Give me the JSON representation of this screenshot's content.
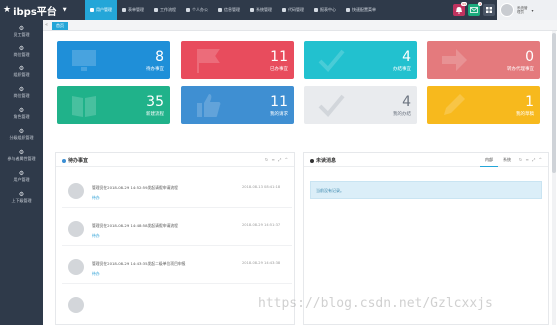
{
  "app": {
    "brand": "ibps平台"
  },
  "topnav": [
    {
      "label": "用户管理",
      "icon": "user-icon",
      "active": true
    },
    {
      "label": "表单管理",
      "icon": "form-icon",
      "active": false
    },
    {
      "label": "工作流程",
      "icon": "flow-icon",
      "active": false
    },
    {
      "label": "个人办公",
      "icon": "office-icon",
      "active": false
    },
    {
      "label": "信息管理",
      "icon": "info-icon",
      "active": false
    },
    {
      "label": "系统管理",
      "icon": "system-icon",
      "active": false
    },
    {
      "label": "代码管理",
      "icon": "code-icon",
      "active": false
    },
    {
      "label": "报表中心",
      "icon": "report-icon",
      "active": false
    },
    {
      "label": "快速配置菜单",
      "icon": "menu-config-icon",
      "active": false
    }
  ],
  "header_badges": [
    {
      "icon": "bell-icon",
      "count": "99",
      "color": "#c0335f"
    },
    {
      "icon": "mail-icon",
      "count": "4",
      "color": "#1bab7d"
    }
  ],
  "user": {
    "line1": "系统管",
    "line2": "理员"
  },
  "sidebar": {
    "items": [
      {
        "label": "员工管理"
      },
      {
        "label": "岗位管理"
      },
      {
        "label": "组织管理"
      },
      {
        "label": "岗位管理"
      },
      {
        "label": "角色管理"
      },
      {
        "label": "分级组织管理"
      },
      {
        "label": "参与者属性管理"
      },
      {
        "label": "用户管理"
      },
      {
        "label": "上下级管理"
      }
    ]
  },
  "tabs": [
    {
      "label": "首页"
    }
  ],
  "cards": [
    {
      "value": "8",
      "label": "待办事宜",
      "color": "#1f8fd8",
      "style": "color"
    },
    {
      "value": "11",
      "label": "已办事宜",
      "color": "#e84c5d",
      "style": "color"
    },
    {
      "value": "4",
      "label": "办结事宜",
      "color": "#22c1cf",
      "style": "color"
    },
    {
      "value": "0",
      "label": "转办代理事宜",
      "color": "#e47a7d",
      "style": "color"
    },
    {
      "value": "35",
      "label": "新建流程",
      "color": "#20b28a",
      "style": "color"
    },
    {
      "value": "11",
      "label": "我的请求",
      "color": "#3f8fd2",
      "style": "color"
    },
    {
      "value": "4",
      "label": "我的办结",
      "color": "#e9ebee",
      "style": "grey"
    },
    {
      "value": "1",
      "label": "我的草稿",
      "color": "#f7b91d",
      "style": "color"
    }
  ],
  "todo_panel": {
    "title": "待办事宜",
    "rows": [
      {
        "text": "管理员在2018-08-29 14:52:59发起请假申请流程",
        "tag": "待办",
        "time": "2018-08-13 08:41:18"
      },
      {
        "text": "管理员在2018-08-29 14:48:58发起请假申请流程",
        "tag": "待办",
        "time": "2018-08-29 14:51:37"
      },
      {
        "text": "管理员在2018-08-29 14:43:35发起二级单位项目申报",
        "tag": "待办",
        "time": "2018-08-29 14:43:38"
      }
    ]
  },
  "msg_panel": {
    "title": "未读消息",
    "tabs": [
      "内部",
      "系统"
    ],
    "empty_text": "当前没有记录。"
  },
  "watermark": "https://blog.csdn.net/Gzlcxxjs"
}
